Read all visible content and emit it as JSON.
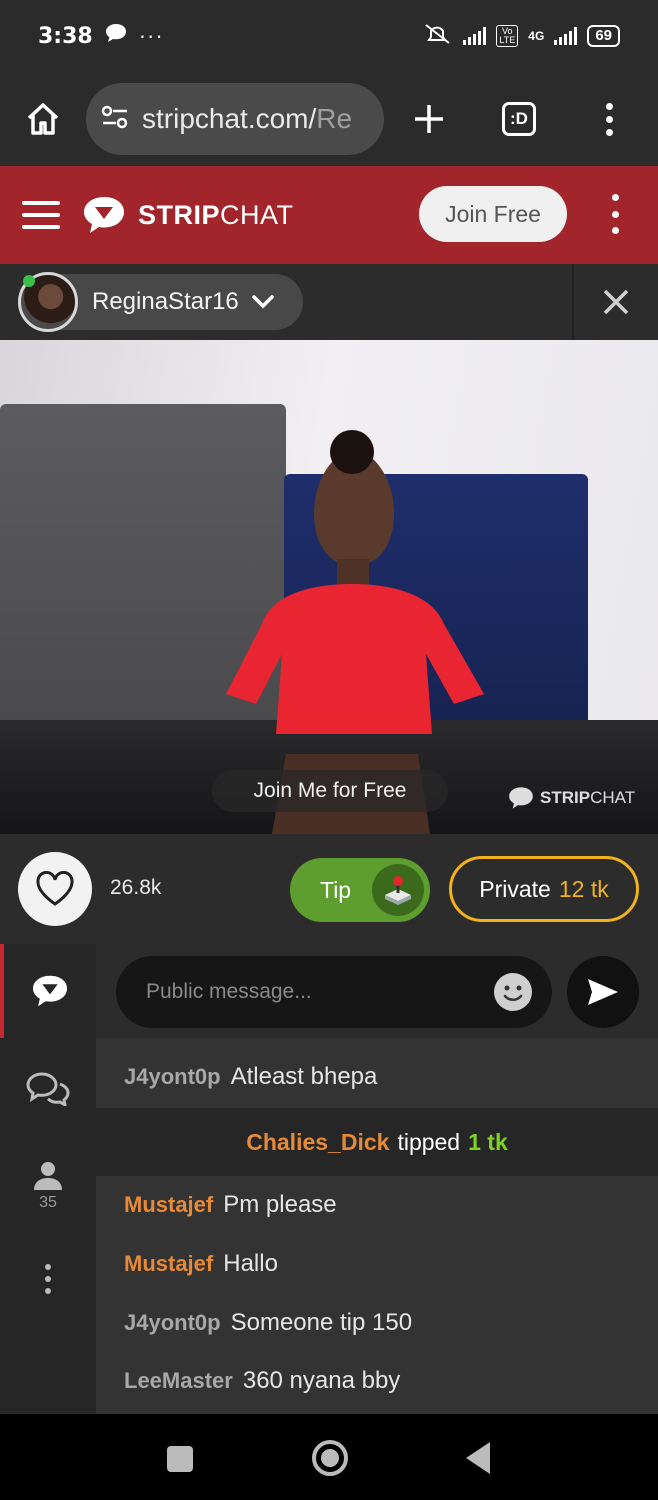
{
  "status_bar": {
    "time": "3:38",
    "battery": "69",
    "network": "4G",
    "volte": "Vo LTE"
  },
  "browser": {
    "url_main": "stripchat.com/",
    "url_tail": "Re",
    "tab_count": ":D"
  },
  "header": {
    "logo_strong": "STRIP",
    "logo_light": "CHAT",
    "join_label": "Join Free"
  },
  "model": {
    "name": "ReginaStar16",
    "online": true
  },
  "video": {
    "overlay_label": "Join Me for Free",
    "watermark_strong": "STRIP",
    "watermark_light": "CHAT"
  },
  "actions": {
    "like_count": "26.8k",
    "tip_label": "Tip",
    "private_label": "Private",
    "private_price": "12 tk"
  },
  "sidebar": {
    "users_count": "35"
  },
  "composer": {
    "placeholder": "Public message..."
  },
  "chat": {
    "messages": [
      {
        "user": "J4yont0p",
        "text": "Atleast bhepa",
        "highlight": false
      },
      {
        "user": "Mustajef",
        "text": "Pm please",
        "highlight": true
      },
      {
        "user": "Mustajef",
        "text": "Hallo",
        "highlight": true
      },
      {
        "user": "J4yont0p",
        "text": "Someone tip 150",
        "highlight": false
      },
      {
        "user": "LeeMaster",
        "text": "360 nyana bby",
        "highlight": false
      }
    ],
    "tip_event": {
      "user": "Chalies_Dick",
      "verb": "tipped",
      "amount": "1 tk"
    }
  },
  "colors": {
    "header_red": "#a2252b",
    "tip_green": "#5e9e2f",
    "private_gold": "#f2b21c",
    "username_orange": "#e68a37",
    "tip_amount_green": "#7ed321"
  }
}
